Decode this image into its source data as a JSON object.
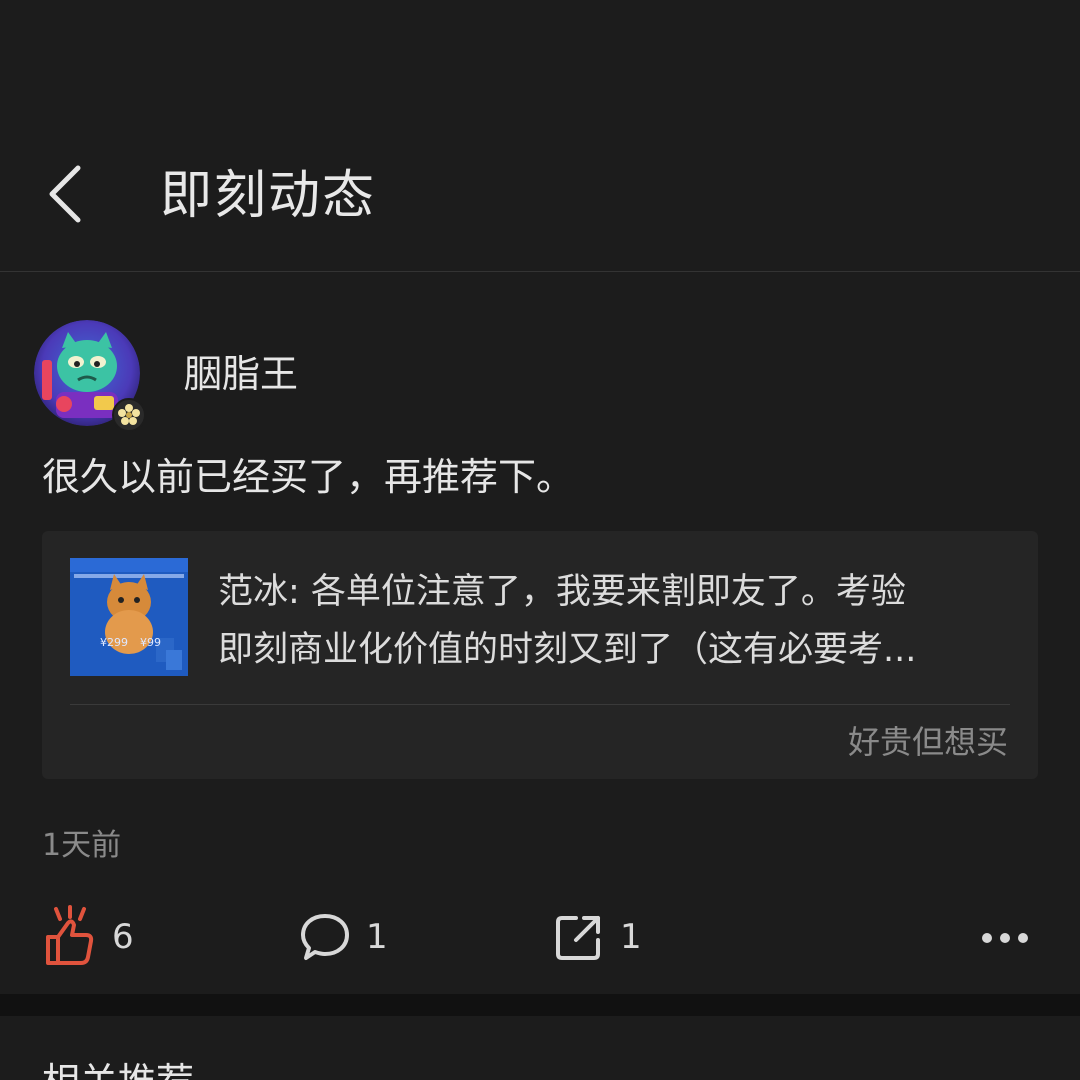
{
  "header": {
    "title": "即刻动态"
  },
  "post": {
    "username": "胭脂王",
    "text": "很久以前已经买了，再推荐下。",
    "shared": {
      "line1": "范冰: 各单位注意了，我要来割即友了。考验",
      "line2": "即刻商业化价值的时刻又到了（这有必要考...",
      "tag": "好贵但想买",
      "thumb": {
        "price_left": "¥299",
        "price_right": "¥99"
      }
    },
    "time": "1天前"
  },
  "actions": {
    "like_count": "6",
    "comment_count": "1",
    "share_count": "1"
  },
  "related": {
    "title": "相关推荐"
  },
  "colors": {
    "background": "#1c1c1c",
    "card": "#252525",
    "like_accent": "#e0533d"
  }
}
